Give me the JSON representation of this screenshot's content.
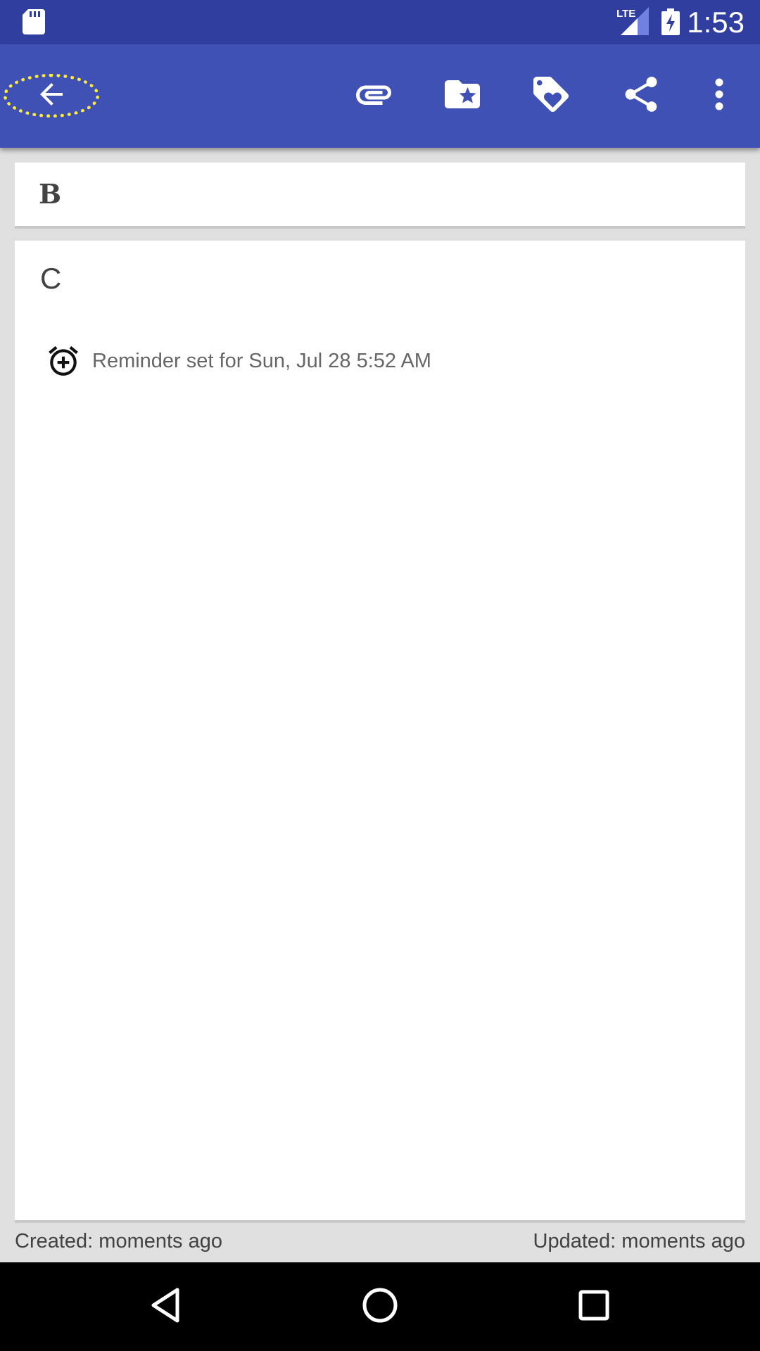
{
  "status_bar": {
    "time": "1:53",
    "network": "LTE",
    "icons": [
      "sd-card-icon",
      "lte-signal-icon",
      "battery-charging-icon"
    ]
  },
  "toolbar": {
    "icons": [
      "back-arrow-icon",
      "attachment-icon",
      "folder-star-icon",
      "tag-heart-icon",
      "share-icon",
      "more-vert-icon"
    ],
    "accent": "#3f51b5",
    "status_color": "#303f9f",
    "highlight_color": "#ffeb3b"
  },
  "note": {
    "title": "B",
    "content": "C",
    "reminder": "Reminder set for Sun, Jul 28 5:52 AM"
  },
  "footer": {
    "created": "Created: moments ago",
    "updated": "Updated: moments ago"
  },
  "nav_bar": {
    "icons": [
      "nav-back-icon",
      "nav-home-icon",
      "nav-recents-icon"
    ]
  }
}
